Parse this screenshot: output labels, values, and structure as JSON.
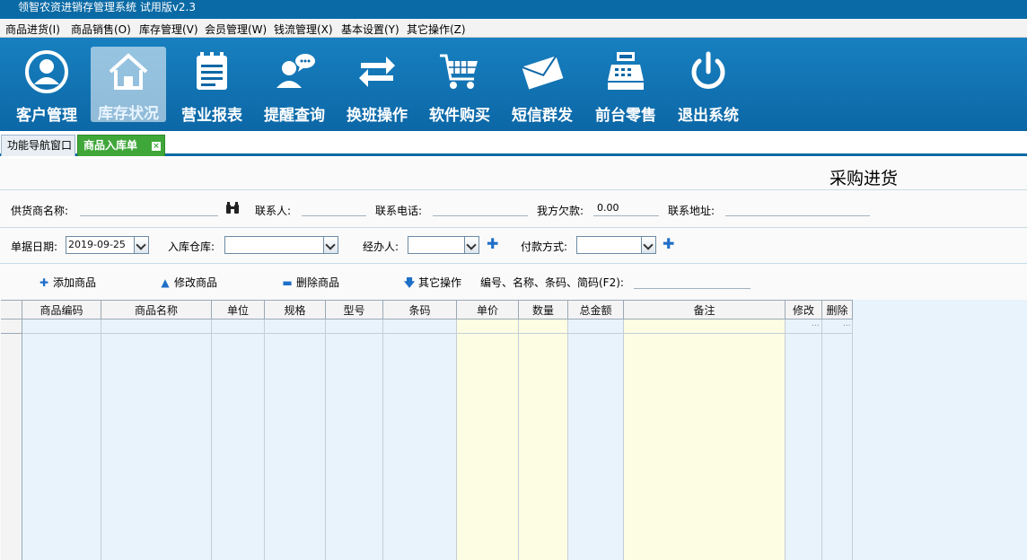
{
  "window": {
    "title": "领智农资进销存管理系统 试用版v2.3"
  },
  "menu": [
    "商品进货(I)",
    "商品销售(O)",
    "库存管理(V)",
    "会员管理(W)",
    "钱流管理(X)",
    "基本设置(Y)",
    "其它操作(Z)"
  ],
  "toolbar": {
    "items": [
      {
        "label": "客户管理",
        "icon": "user-circle-icon"
      },
      {
        "label": "库存状况",
        "icon": "home-icon",
        "active": true
      },
      {
        "label": "营业报表",
        "icon": "report-icon"
      },
      {
        "label": "提醒查询",
        "icon": "chat-user-icon"
      },
      {
        "label": "换班操作",
        "icon": "swap-icon"
      },
      {
        "label": "软件购买",
        "icon": "cart-icon"
      },
      {
        "label": "短信群发",
        "icon": "envelope-icon"
      },
      {
        "label": "前台零售",
        "icon": "cash-register-icon"
      },
      {
        "label": "退出系统",
        "icon": "power-icon"
      }
    ]
  },
  "tabs": [
    {
      "label": "功能导航窗口",
      "active": false
    },
    {
      "label": "商品入库单",
      "active": true,
      "close": "×"
    }
  ],
  "form": {
    "title": "采购进货",
    "supplier_label": "供货商名称:",
    "contact_label": "联系人:",
    "phone_label": "联系电话:",
    "debt_label": "我方欠款:",
    "debt_value": "0.00",
    "address_label": "联系地址:",
    "date_label": "单据日期:",
    "date_value": "2019-09-25",
    "warehouse_label": "入库仓库:",
    "handler_label": "经办人:",
    "payment_label": "付款方式:"
  },
  "actions": {
    "add": "添加商品",
    "edit": "修改商品",
    "delete": "删除商品",
    "other": "其它操作",
    "search_label": "编号、名称、条码、简码(F2):"
  },
  "grid": {
    "columns": [
      "商品编码",
      "商品名称",
      "单位",
      "规格",
      "型号",
      "条码",
      "单价",
      "数量",
      "总金额",
      "备注",
      "修改",
      "删除"
    ],
    "row_cells": {
      "edit": "...",
      "delete": "..."
    }
  },
  "colors": {
    "accent": "#0a6aa5",
    "active_tab": "#3fa63a",
    "grid_blue": "#e8f3fb",
    "grid_yellow": "#fdfde3",
    "icon_blue": "#1e6fc8"
  }
}
